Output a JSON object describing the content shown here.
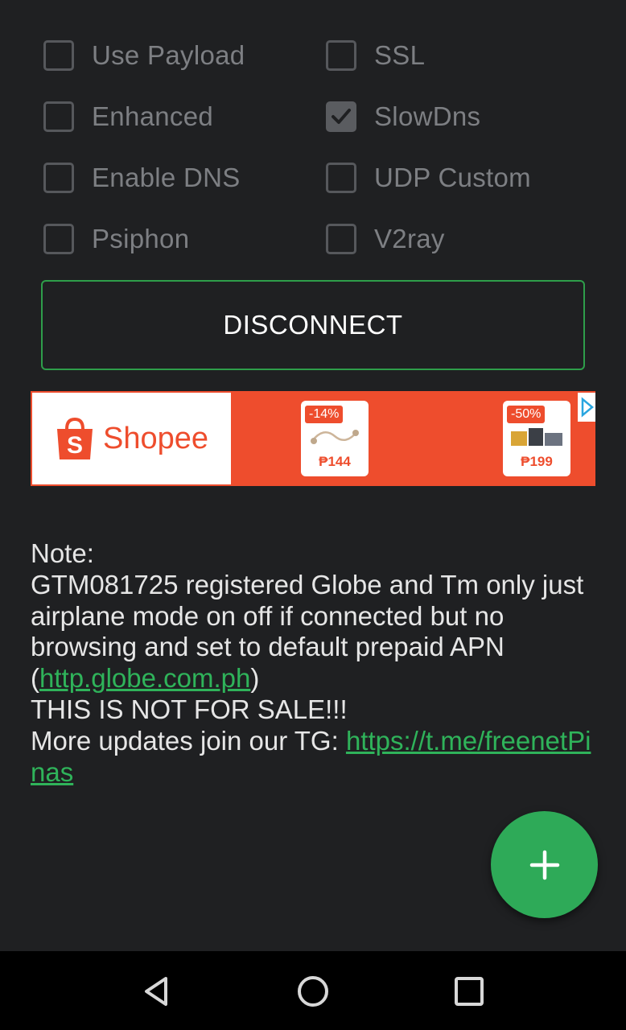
{
  "options": [
    {
      "label": "Use Payload",
      "checked": false
    },
    {
      "label": "SSL",
      "checked": false
    },
    {
      "label": "Enhanced",
      "checked": false
    },
    {
      "label": "SlowDns",
      "checked": true
    },
    {
      "label": "Enable DNS",
      "checked": false
    },
    {
      "label": "UDP Custom",
      "checked": false
    },
    {
      "label": "Psiphon",
      "checked": false
    },
    {
      "label": "V2ray",
      "checked": false
    }
  ],
  "disconnect_label": "DISCONNECT",
  "ad": {
    "brand": "Shopee",
    "products": [
      {
        "discount": "-14%",
        "price": "₱144"
      },
      {
        "discount": "-50%",
        "price": "₱199"
      }
    ]
  },
  "note": {
    "heading": "Note:",
    "line1": "GTM081725 registered Globe and Tm only just airplane mode on off if connected but no browsing and set to default prepaid APN (",
    "apn_link": "http.globe.com.ph",
    "line1_end": ")",
    "line2": "THIS IS NOT FOR SALE!!!",
    "line3": "More updates join our TG: ",
    "tg_link": "https://t.me/freenetPinas"
  },
  "fab_icon": "plus-icon",
  "nav": [
    "back-icon",
    "home-icon",
    "recents-icon"
  ],
  "colors": {
    "accent": "#2eaa58",
    "ad": "#ee4d2d"
  }
}
